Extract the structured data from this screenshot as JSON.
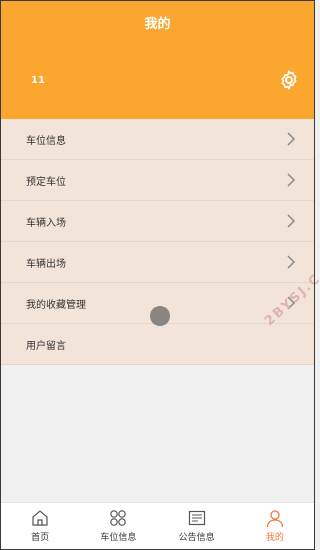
{
  "header": {
    "title": "我的",
    "username": "11"
  },
  "menu": {
    "items": [
      {
        "label": "车位信息",
        "has_arrow": true
      },
      {
        "label": "预定车位",
        "has_arrow": true
      },
      {
        "label": "车辆入场",
        "has_arrow": true
      },
      {
        "label": "车辆出场",
        "has_arrow": true
      },
      {
        "label": "我的收藏管理",
        "has_arrow": true
      },
      {
        "label": "用户留言",
        "has_arrow": false
      }
    ]
  },
  "watermark": "2BYSJ.C",
  "tabbar": {
    "tabs": [
      {
        "label": "首页",
        "icon": "home-icon"
      },
      {
        "label": "车位信息",
        "icon": "grid-icon"
      },
      {
        "label": "公告信息",
        "icon": "notice-icon"
      },
      {
        "label": "我的",
        "icon": "user-icon",
        "active": true
      }
    ]
  },
  "colors": {
    "accent": "#fba62f",
    "menu_bg": "#f3e4da",
    "active_tab": "#f07b3f"
  }
}
